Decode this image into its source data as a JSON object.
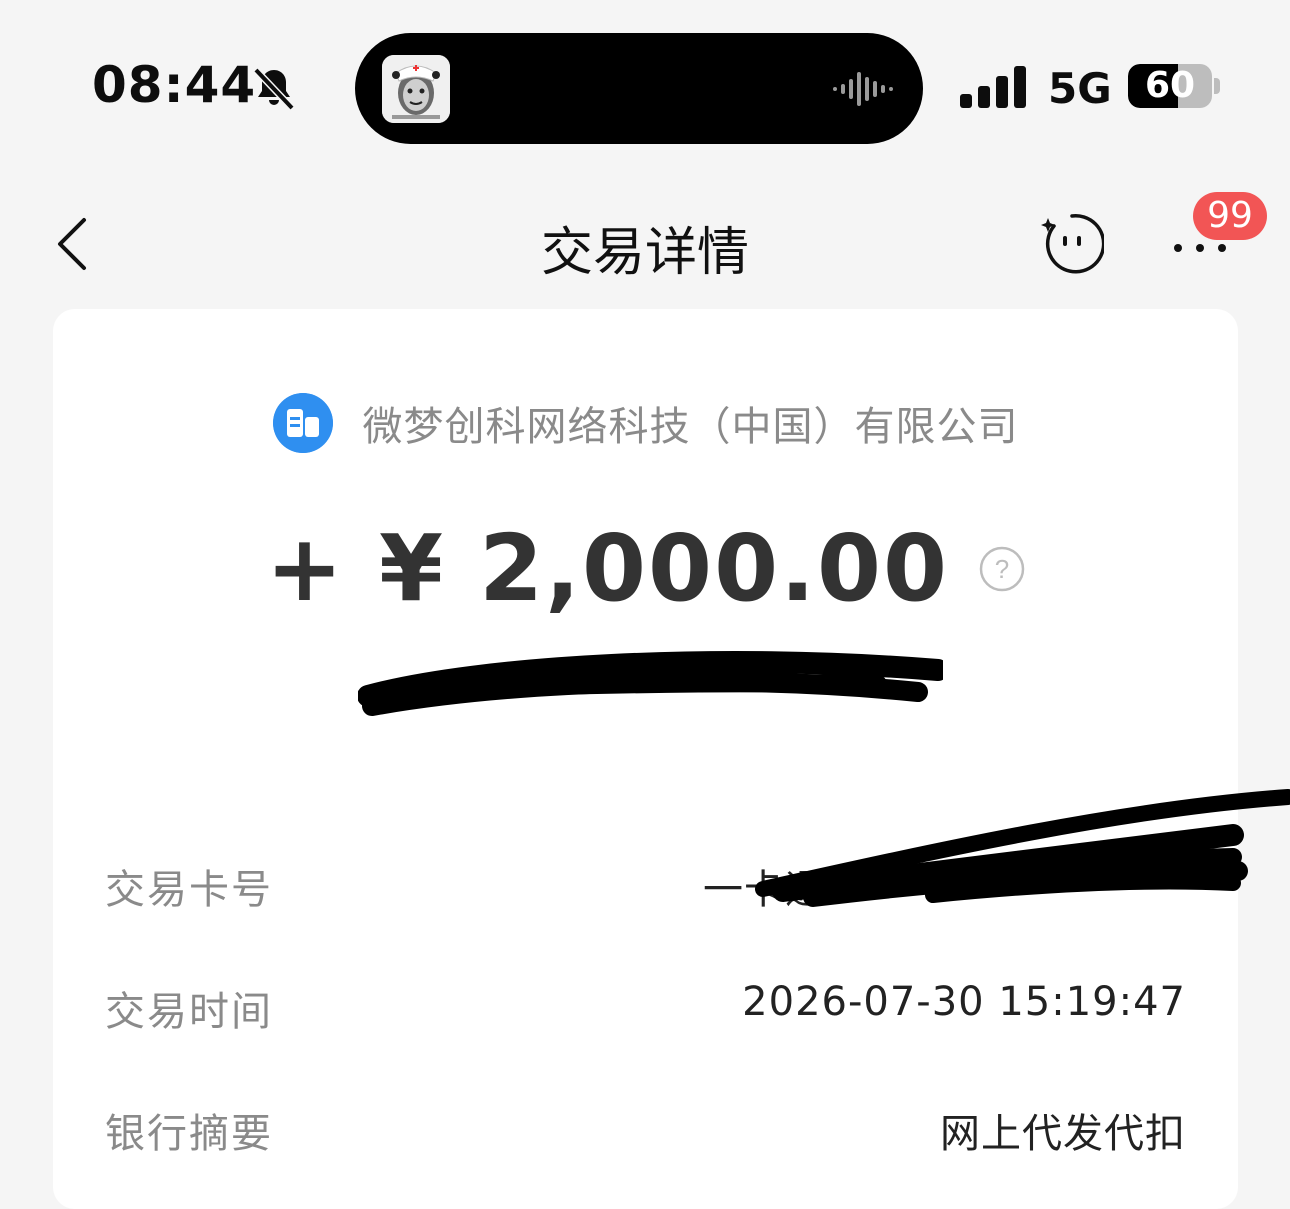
{
  "status_bar": {
    "time": "08:44",
    "network": "5G",
    "battery_percent": 60,
    "battery_label": "60",
    "icons": [
      "bell-muted-icon",
      "waveform-icon",
      "signal-icon",
      "battery-icon"
    ]
  },
  "nav": {
    "title": "交易详情",
    "back_icon": "chevron-left-icon",
    "assistant_icon": "smiley-assistant-icon",
    "more_icon": "more-dots-icon",
    "badge_count": "99"
  },
  "merchant": {
    "name": "微梦创科网络科技（中国）有限公司",
    "icon": "building-icon",
    "icon_color": "#2f8ff0"
  },
  "transaction": {
    "amount": "+ ¥ 2,000.00",
    "help_icon": "question-circle-icon"
  },
  "details": [
    {
      "label": "交易卡号",
      "value": "一卡通"
    },
    {
      "label": "交易时间",
      "value": "2026-07-30 15:19:47"
    },
    {
      "label": "银行摘要",
      "value": "网上代发代扣"
    }
  ],
  "colors": {
    "page_bg": "#f5f5f5",
    "card_bg": "#ffffff",
    "badge": "#f25555",
    "label_gray": "#8a8a8a"
  }
}
